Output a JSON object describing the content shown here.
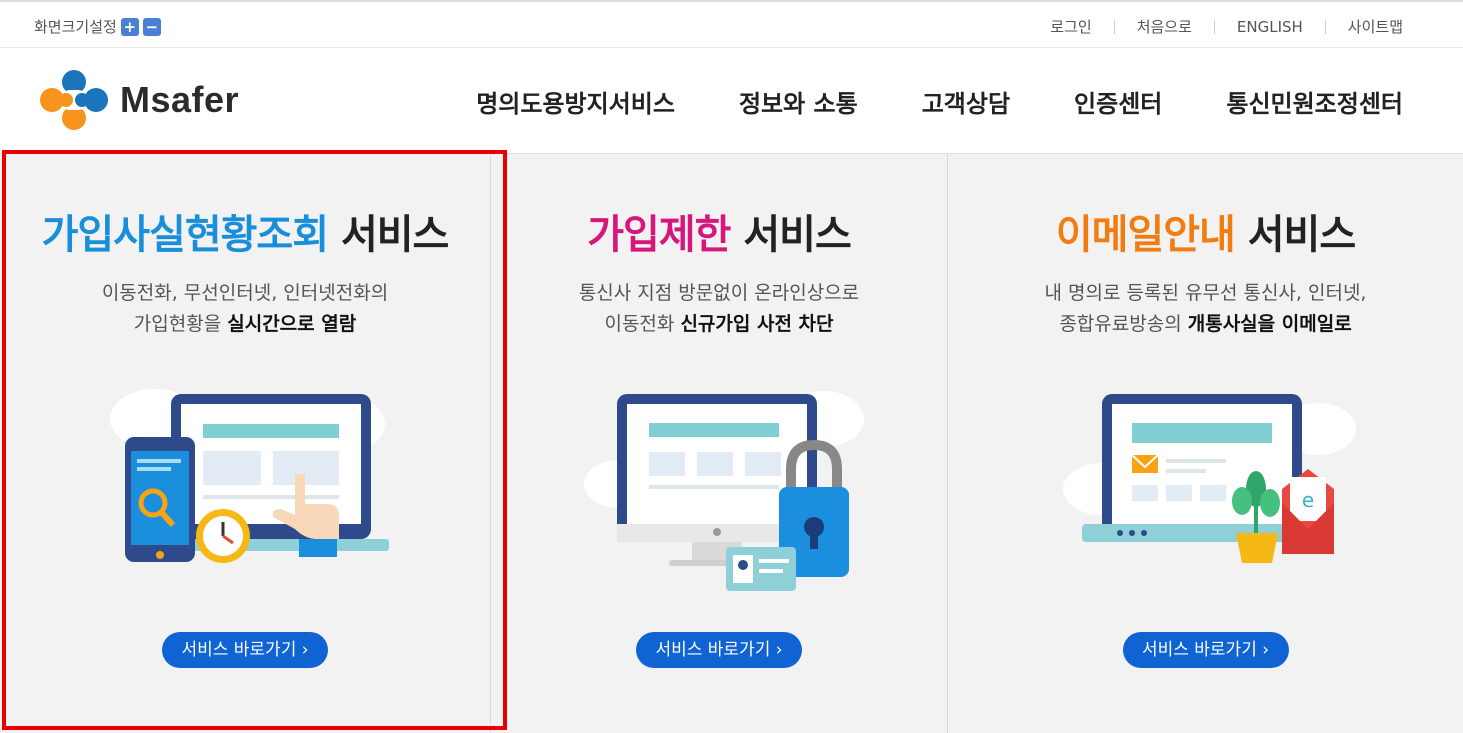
{
  "utility": {
    "zoom_label": "화면크기설정",
    "zoom_in": "+",
    "zoom_out": "−",
    "links": [
      "로그인",
      "처음으로",
      "ENGLISH",
      "사이트맵"
    ]
  },
  "header": {
    "logo_text": "Msafer",
    "nav": [
      "명의도용방지서비스",
      "정보와 소통",
      "고객상담",
      "인증센터",
      "통신민원조정센터"
    ]
  },
  "colors": {
    "blue_title": "#1a8fd9",
    "pink_title": "#d6167b",
    "orange_title": "#f07d12",
    "button": "#1063d2",
    "highlight": "#e60000"
  },
  "panels": [
    {
      "title_accent": "가입사실현황조회",
      "title_rest": " 서비스",
      "desc_line1": "이동전화, 무선인터넷, 인터넷전화의",
      "desc_line2_plain": "가입현황을 ",
      "desc_line2_bold": "실시간으로 열람",
      "button": "서비스 바로가기 ›",
      "illustration": "monitor-phone-search-clock-icon"
    },
    {
      "title_accent": "가입제한",
      "title_rest": " 서비스",
      "desc_line1": "통신사 지점 방문없이 온라인상으로",
      "desc_line2_plain": "이동전화 ",
      "desc_line2_bold": "신규가입 사전 차단",
      "button": "서비스 바로가기 ›",
      "illustration": "monitor-lock-shield-icon"
    },
    {
      "title_accent": "이메일안내",
      "title_rest": " 서비스",
      "desc_line1": "내 명의로 등록된 유무선 통신사, 인터넷,",
      "desc_line2_plain": "종합유료방송의 ",
      "desc_line2_bold": "개통사실을 이메일로",
      "button": "서비스 바로가기 ›",
      "illustration": "laptop-envelope-plant-icon"
    }
  ]
}
